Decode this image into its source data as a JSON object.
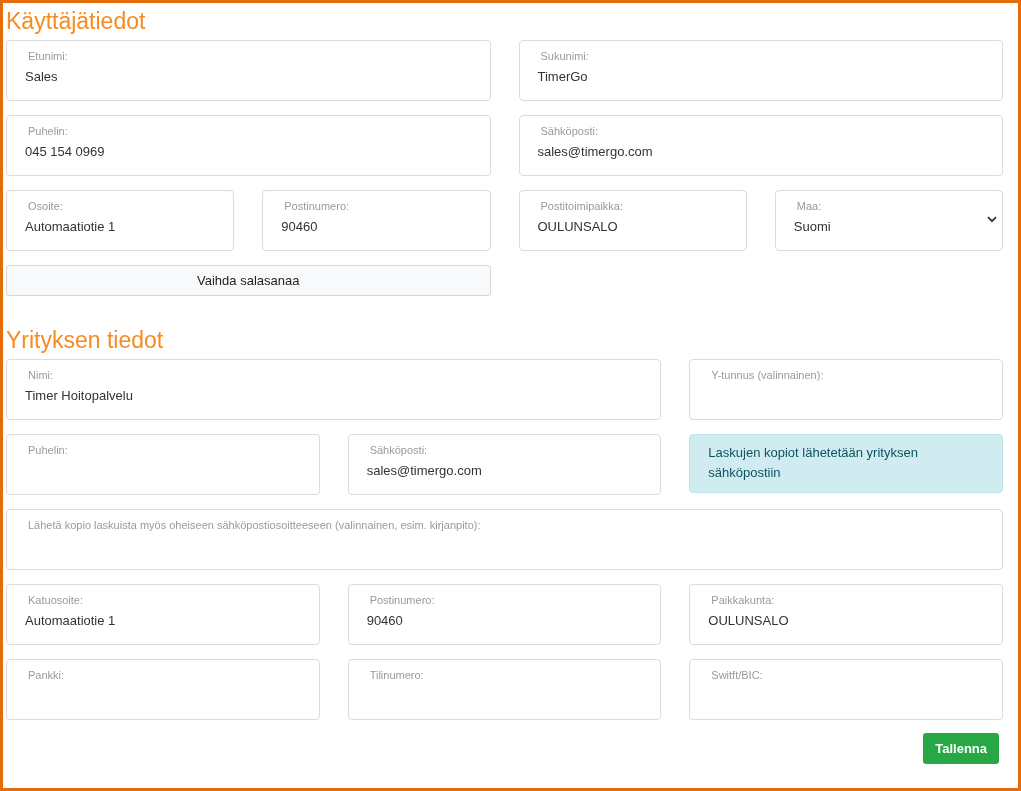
{
  "sections": [
    {
      "title": "Käyttäjätiedot",
      "items": [
        {
          "kind": "field",
          "label": "Etunimi:",
          "value": "Sales"
        },
        {
          "kind": "field",
          "label": "Sukunimi:",
          "value": "TimerGo"
        },
        {
          "kind": "field",
          "label": "Puhelin:",
          "value": "045 154 0969"
        },
        {
          "kind": "field",
          "label": "Sähköposti:",
          "value": "sales@timergo.com"
        },
        {
          "kind": "field",
          "label": "Osoite:",
          "value": "Automaatiotie 1"
        },
        {
          "kind": "field",
          "label": "Postinumero:",
          "value": "90460"
        },
        {
          "kind": "field",
          "label": "Postitoimipaikka:",
          "value": "OULUNSALO"
        },
        {
          "kind": "select",
          "label": "Maa:",
          "value": "Suomi"
        },
        {
          "kind": "button",
          "label": "Vaihda salasanaa"
        }
      ]
    },
    {
      "title": "Yrityksen tiedot",
      "items": [
        {
          "kind": "field",
          "label": "Nimi:",
          "value": "Timer Hoitopalvelu"
        },
        {
          "kind": "field",
          "label": "Y-tunnus (valinnainen):"
        },
        {
          "kind": "field",
          "label": "Puhelin:"
        },
        {
          "kind": "field",
          "label": "Sähköposti:",
          "value": "sales@timergo.com"
        },
        {
          "kind": "note",
          "label": "Laskujen kopiot lähetetään yrityksen sähköpostiin"
        },
        {
          "kind": "field",
          "label": "Lähetä kopio laskuista myös oheiseen sähköpostiosoitteeseen (valinnainen, esim. kirjanpito):"
        },
        {
          "kind": "field",
          "label": "Katuosoite:",
          "value": "Automaatiotie 1"
        },
        {
          "kind": "field",
          "label": "Postinumero:",
          "value": "90460"
        },
        {
          "kind": "field",
          "label": "Paikkakunta:",
          "value": "OULUNSALO"
        },
        {
          "kind": "field",
          "label": "Pankki:"
        },
        {
          "kind": "field",
          "label": "Tilinumero:"
        },
        {
          "kind": "field",
          "label": "Switft/BIC:"
        }
      ]
    }
  ],
  "save_button": "Tallenna"
}
